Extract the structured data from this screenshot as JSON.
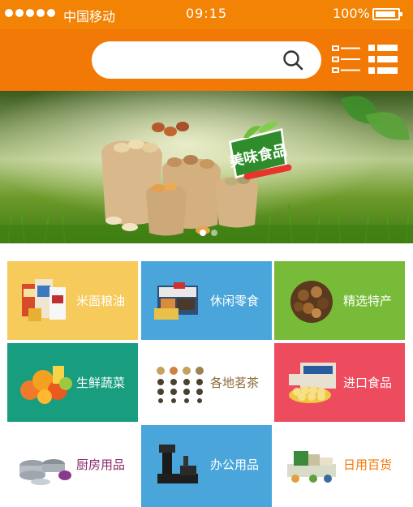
{
  "status_bar": {
    "carrier": "中国移动",
    "time": "09:15",
    "battery": "100%"
  },
  "search": {
    "placeholder": ""
  },
  "banner": {
    "brand_text": "美味食品",
    "slide_count": 2,
    "active_slide": 1
  },
  "categories": [
    {
      "label": "米面粮油",
      "bg": "#f6ca5b",
      "text_color": "#ffffff"
    },
    {
      "label": "休闲零食",
      "bg": "#4aa6da",
      "text_color": "#ffffff"
    },
    {
      "label": "精选特产",
      "bg": "#78bb38",
      "text_color": "#ffffff"
    },
    {
      "label": "生鲜蔬菜",
      "bg": "#189d7f",
      "text_color": "#ffffff"
    },
    {
      "label": "各地茗茶",
      "bg": "#ffffff",
      "text_color": "#8a6a3a"
    },
    {
      "label": "进口食品",
      "bg": "#ec4c5e",
      "text_color": "#ffffff"
    },
    {
      "label": "厨房用品",
      "bg": "#ffffff",
      "text_color": "#8b2a6a"
    },
    {
      "label": "办公用品",
      "bg": "#4aa6da",
      "text_color": "#ffffff"
    },
    {
      "label": "日用百货",
      "bg": "#ffffff",
      "text_color": "#f27905"
    }
  ],
  "colors": {
    "header": "#f27905",
    "status_bar": "#f28305"
  }
}
